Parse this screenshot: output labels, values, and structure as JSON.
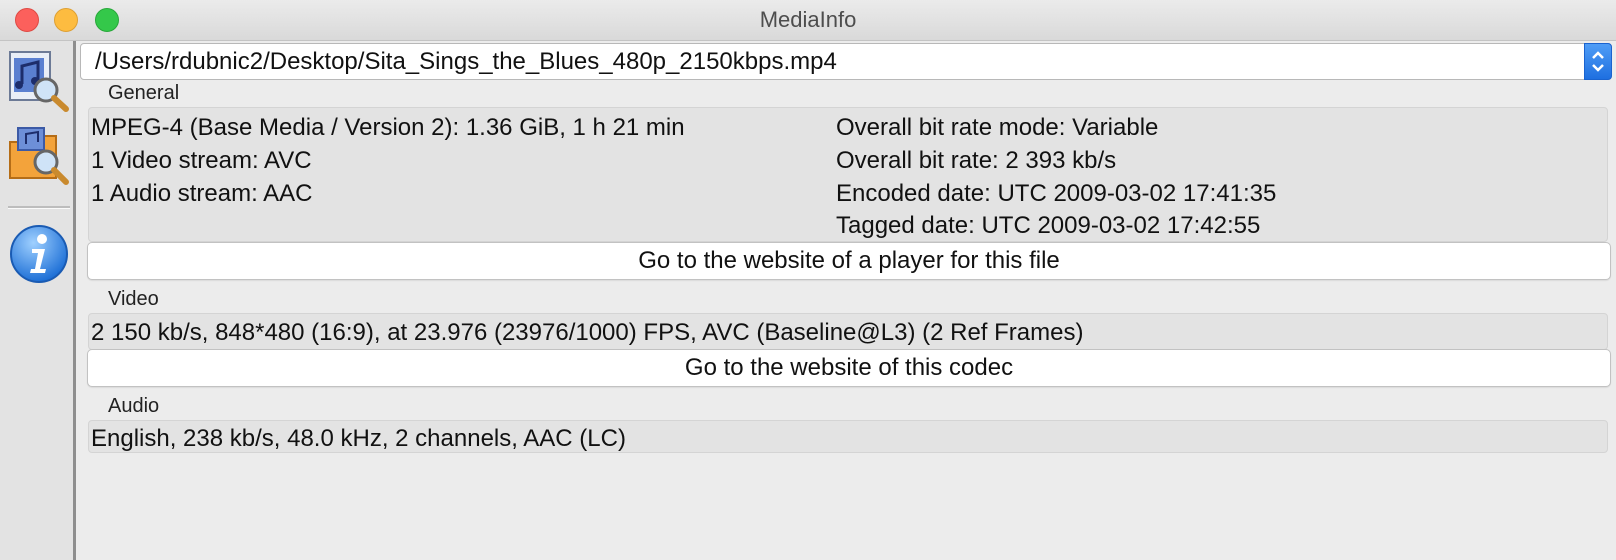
{
  "window": {
    "title": "MediaInfo"
  },
  "file": {
    "path": "/Users/rdubnic2/Desktop/Sita_Sings_the_Blues_480p_2150kbps.mp4"
  },
  "sidebar": {
    "buttons": [
      {
        "icon": "open-file-icon"
      },
      {
        "icon": "open-folder-icon"
      },
      {
        "icon": "info-icon"
      }
    ]
  },
  "general": {
    "label": "General",
    "left_lines": [
      "MPEG-4 (Base Media / Version 2): 1.36 GiB, 1 h 21 min",
      "1 Video stream: AVC",
      "1 Audio stream: AAC"
    ],
    "right_lines": [
      "Overall bit rate mode: Variable",
      "Overall bit rate: 2 393 kb/s",
      "Encoded date: UTC 2009-03-02 17:41:35",
      "Tagged date: UTC 2009-03-02 17:42:55"
    ],
    "button_label": "Go to the website of a player for this file"
  },
  "video": {
    "label": "Video",
    "line": "2 150 kb/s, 848*480 (16:9), at 23.976 (23976/1000) FPS, AVC (Baseline@L3) (2 Ref Frames)",
    "button_label": "Go to the website of this codec"
  },
  "audio": {
    "label": "Audio",
    "line": "English, 238 kb/s, 48.0 kHz, 2 channels, AAC (LC)"
  }
}
